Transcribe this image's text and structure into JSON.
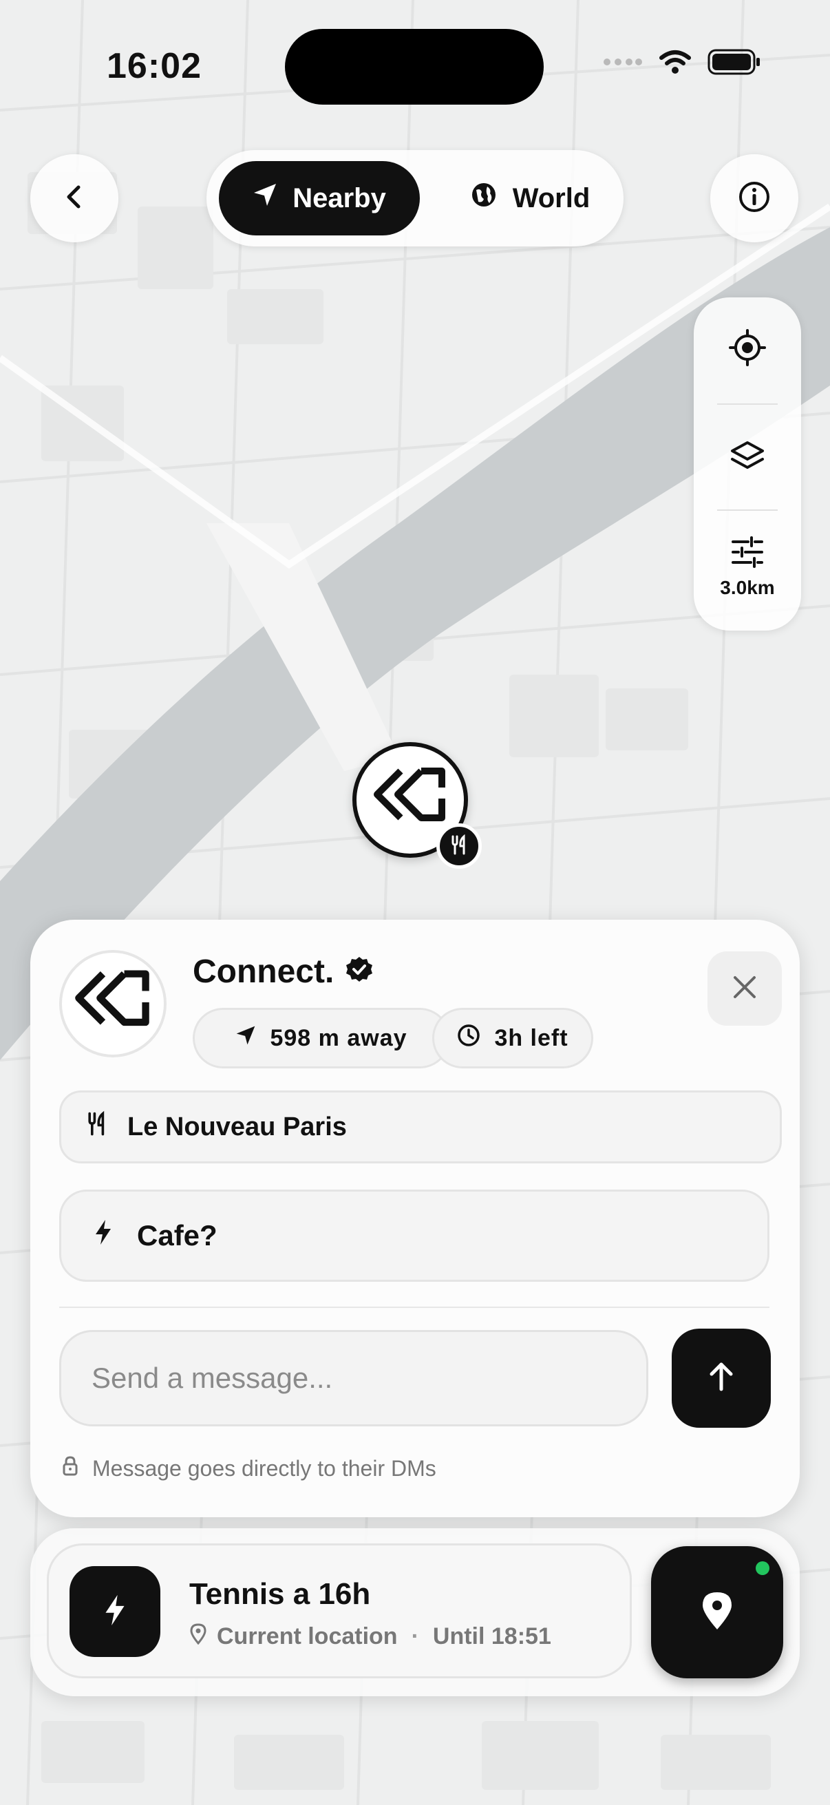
{
  "status_bar": {
    "time": "16:02"
  },
  "mode_switch": {
    "nearby_label": "Nearby",
    "world_label": "World",
    "selected": "Nearby"
  },
  "map_tools": {
    "radius_label": "3.0km"
  },
  "card": {
    "name": "Connect.",
    "verified": true,
    "distance": "598 m away",
    "time_left": "3h left",
    "place": "Le Nouveau Paris",
    "status_text": "Cafe?",
    "message_placeholder": "Send a message...",
    "hint": "Message goes directly to their DMs"
  },
  "activity": {
    "title": "Tennis a 16h",
    "location": "Current location",
    "until": "Until 18:51"
  },
  "colors": {
    "accent": "#111111",
    "online": "#22c55e",
    "map_bg": "#eeefef",
    "water": "#c9cdcf"
  }
}
